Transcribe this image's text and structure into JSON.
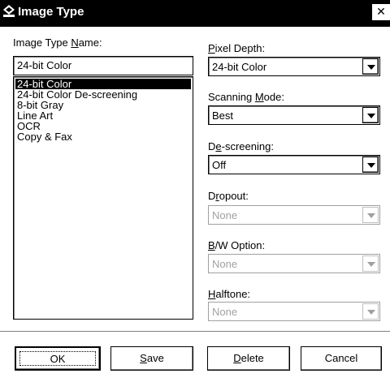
{
  "window": {
    "title": "Image Type",
    "close_glyph": "✕"
  },
  "name_label_pre": "Image Type ",
  "name_label_accel": "N",
  "name_label_post": "ame:",
  "name_value": "24-bit Color",
  "list_items": [
    "24-bit Color",
    "24-bit Color De-screening",
    "8-bit Gray",
    "Line Art",
    "OCR",
    "Copy & Fax"
  ],
  "pixel_depth": {
    "accel": "P",
    "rest": "ixel Depth:",
    "value": "24-bit Color"
  },
  "scanning_mode": {
    "pre": "Scanning ",
    "accel": "M",
    "post": "ode:",
    "value": "Best"
  },
  "descreening": {
    "pre": "D",
    "accel": "e",
    "post": "-screening:",
    "value": "Off"
  },
  "dropout": {
    "pre": "D",
    "accel": "r",
    "post": "opout:",
    "value": "None"
  },
  "bw_option": {
    "accel": "B",
    "post": "/W Option:",
    "value": "None"
  },
  "halftone": {
    "accel": "H",
    "post": "alftone:",
    "value": "None"
  },
  "buttons": {
    "ok": "OK",
    "save_accel": "S",
    "save_rest": "ave",
    "delete_accel": "D",
    "delete_rest": "elete",
    "cancel": "Cancel"
  },
  "icons": {
    "title": "scanner-icon",
    "close": "close-icon",
    "dropdown": "chevron-down-icon"
  }
}
